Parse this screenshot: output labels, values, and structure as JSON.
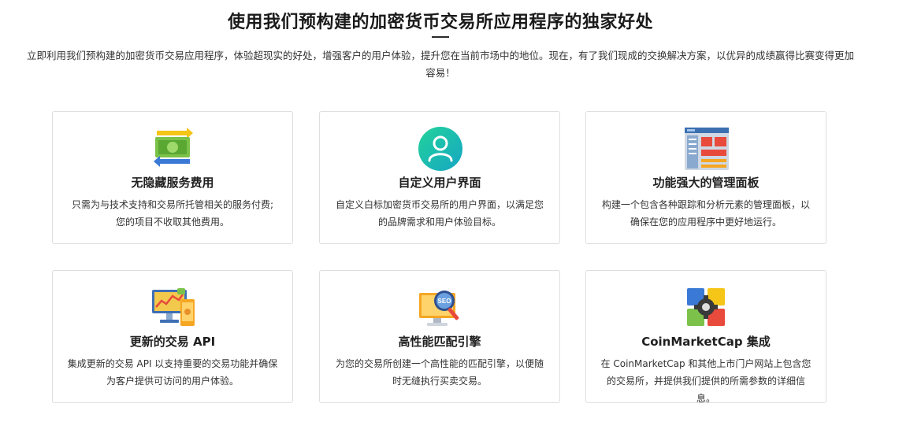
{
  "header": {
    "title": "使用我们预构建的加密货币交易所应用程序的独家好处",
    "intro": "立即利用我们预构建的加密货币交易应用程序，体验超现实的好处，增强客户的用户体验，提升您在当前市场中的地位。现在，有了我们现成的交换解决方案，以优异的成绩赢得比赛变得更加容易！"
  },
  "features": [
    {
      "icon": "money-transfer-icon",
      "title": "无隐藏服务费用",
      "desc": "只需为与技术支持和交易所托管相关的服务付费;您的项目不收取其他费用。"
    },
    {
      "icon": "user-profile-icon",
      "title": "自定义用户界面",
      "desc": "自定义白标加密货币交易所的用户界面，以满足您的品牌需求和用户体验目标。"
    },
    {
      "icon": "dashboard-panel-icon",
      "title": "功能强大的管理面板",
      "desc": "构建一个包含各种跟踪和分析元素的管理面板，以确保在您的应用程序中更好地运行。"
    },
    {
      "icon": "trading-api-icon",
      "title": "更新的交易 API",
      "desc": "集成更新的交易 API 以支持重要的交易功能并确保为客户提供可访问的用户体验。"
    },
    {
      "icon": "seo-monitor-icon",
      "title": "高性能匹配引擎",
      "desc": "为您的交易所创建一个高性能的匹配引擎，以便随时无缝执行买卖交易。"
    },
    {
      "icon": "puzzle-gear-icon",
      "title": "CoinMarketCap 集成",
      "desc": "在 CoinMarketCap 和其他上市门户网站上包含您的交易所，并提供我们提供的所需参数的详细信息。"
    }
  ],
  "colors": {
    "green": "#7cc24a",
    "yellow": "#f5c518",
    "blue": "#3b79d6",
    "teal": "#1ec8a5",
    "red": "#e84a3c"
  }
}
